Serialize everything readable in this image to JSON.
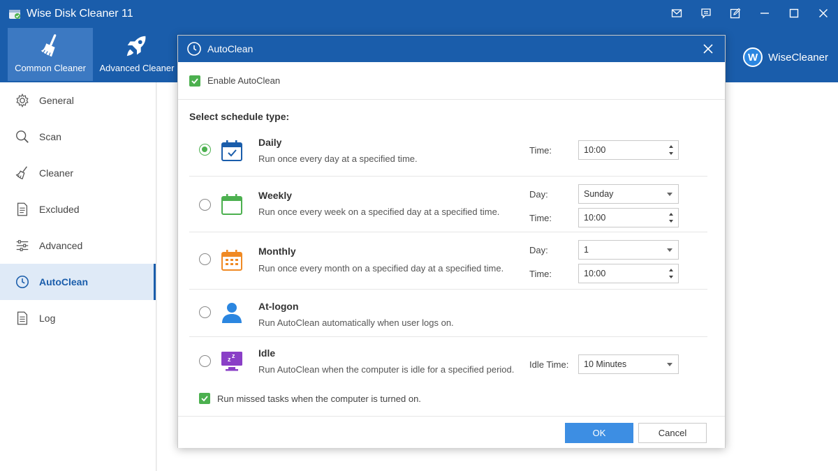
{
  "app": {
    "title": "Wise Disk Cleaner 11",
    "brand": "WiseCleaner",
    "brand_initial": "W"
  },
  "toolbar": [
    {
      "label": "Common Cleaner",
      "icon": "broom-icon",
      "active": true
    },
    {
      "label": "Advanced Cleaner",
      "icon": "rocket-icon",
      "active": false
    }
  ],
  "window_controls": [
    "mail-icon",
    "feedback-icon",
    "edit-icon",
    "minimize-icon",
    "maximize-icon",
    "close-icon"
  ],
  "sidebar": {
    "items": [
      {
        "label": "General",
        "icon": "gear-icon"
      },
      {
        "label": "Scan",
        "icon": "search-icon"
      },
      {
        "label": "Cleaner",
        "icon": "broom-icon"
      },
      {
        "label": "Excluded",
        "icon": "document-icon"
      },
      {
        "label": "Advanced",
        "icon": "sliders-icon"
      },
      {
        "label": "AutoClean",
        "icon": "clock-icon",
        "active": true
      },
      {
        "label": "Log",
        "icon": "log-icon"
      }
    ]
  },
  "dialog": {
    "title": "AutoClean",
    "enable_label": "Enable AutoClean",
    "enable_checked": true,
    "schedule_heading": "Select schedule type:",
    "options": {
      "daily": {
        "title": "Daily",
        "desc": "Run once every day at a specified time.",
        "selected": true,
        "time_label": "Time:",
        "time": "10:00"
      },
      "weekly": {
        "title": "Weekly",
        "desc": "Run once every week on a specified day at a specified time.",
        "selected": false,
        "day_label": "Day:",
        "day": "Sunday",
        "time_label": "Time:",
        "time": "10:00"
      },
      "monthly": {
        "title": "Monthly",
        "desc": "Run once every month on a specified day at a specified time.",
        "selected": false,
        "day_label": "Day:",
        "day": "1",
        "time_label": "Time:",
        "time": "10:00"
      },
      "logon": {
        "title": "At-logon",
        "desc": "Run AutoClean automatically when user logs on.",
        "selected": false
      },
      "idle": {
        "title": "Idle",
        "desc": "Run AutoClean when the computer is idle for a specified period.",
        "selected": false,
        "idle_label": "Idle Time:",
        "idle_time": "10 Minutes"
      }
    },
    "missed_label": "Run missed tasks when the computer is turned on.",
    "missed_checked": true,
    "ok_label": "OK",
    "cancel_label": "Cancel"
  },
  "colors": {
    "header": "#1a5dab",
    "accent_green": "#4cb04f",
    "ok_button": "#3d8ee3"
  }
}
